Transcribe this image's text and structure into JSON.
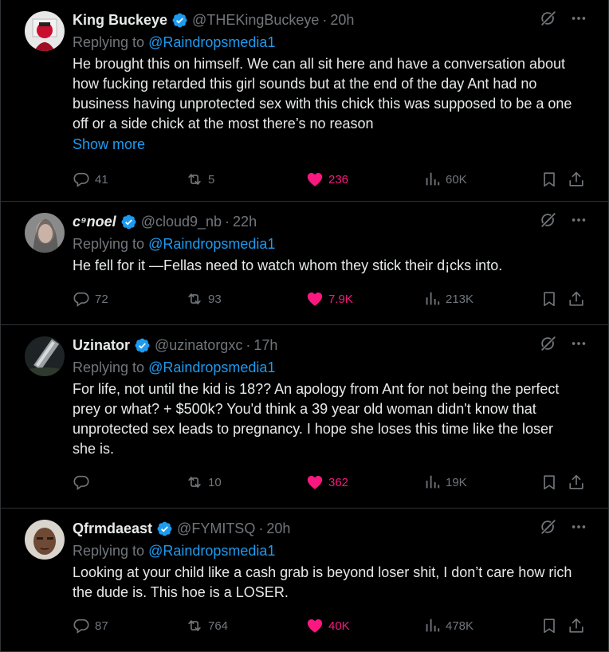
{
  "colors": {
    "accent": "#1d9bf0",
    "like": "#f91880",
    "muted": "#71767b",
    "text": "#e7e9ea",
    "border": "#2f3336"
  },
  "replies": [
    {
      "name": "King Buckeye",
      "handle": "@THEKingBuckeye",
      "time": "20h",
      "replying_label": "Replying to",
      "replying_to": "@Raindropsmedia1",
      "text": "He brought this on himself. We can all sit here and have a conversation about how fucking retarded this girl sounds but at the end of the day Ant had no business having unprotected sex with this chick this was supposed to be a one off or a side chick at the most there’s no reason",
      "show_more": "Show more",
      "replies": "41",
      "reposts": "5",
      "likes": "236",
      "views": "60K"
    },
    {
      "name": "c⁹noel",
      "handle": "@cloud9_nb",
      "time": "22h",
      "replying_label": "Replying to",
      "replying_to": "@Raindropsmedia1",
      "text": "He fell for it —Fellas need to watch whom they stick their d¡cks into.",
      "replies": "72",
      "reposts": "93",
      "likes": "7.9K",
      "views": "213K"
    },
    {
      "name": "Uzinator",
      "handle": "@uzinatorgxc",
      "time": "17h",
      "replying_label": "Replying to",
      "replying_to": "@Raindropsmedia1",
      "text": "For life, not until the kid is 18?? An apology from Ant for not being the perfect prey or what? + $500k? You'd think a 39 year old woman didn't know that unprotected sex leads to pregnancy. I hope she loses this time like the loser she is.",
      "replies": "",
      "reposts": "10",
      "likes": "362",
      "views": "19K"
    },
    {
      "name": "Qfrmdaeast",
      "handle": "@FYMITSQ",
      "time": "20h",
      "replying_label": "Replying to",
      "replying_to": "@Raindropsmedia1",
      "text": "Looking at your child like a cash grab is beyond loser shit, I don’t care how rich the dude is. This hoe is a LOSER.",
      "replies": "87",
      "reposts": "764",
      "likes": "40K",
      "views": "478K"
    }
  ]
}
